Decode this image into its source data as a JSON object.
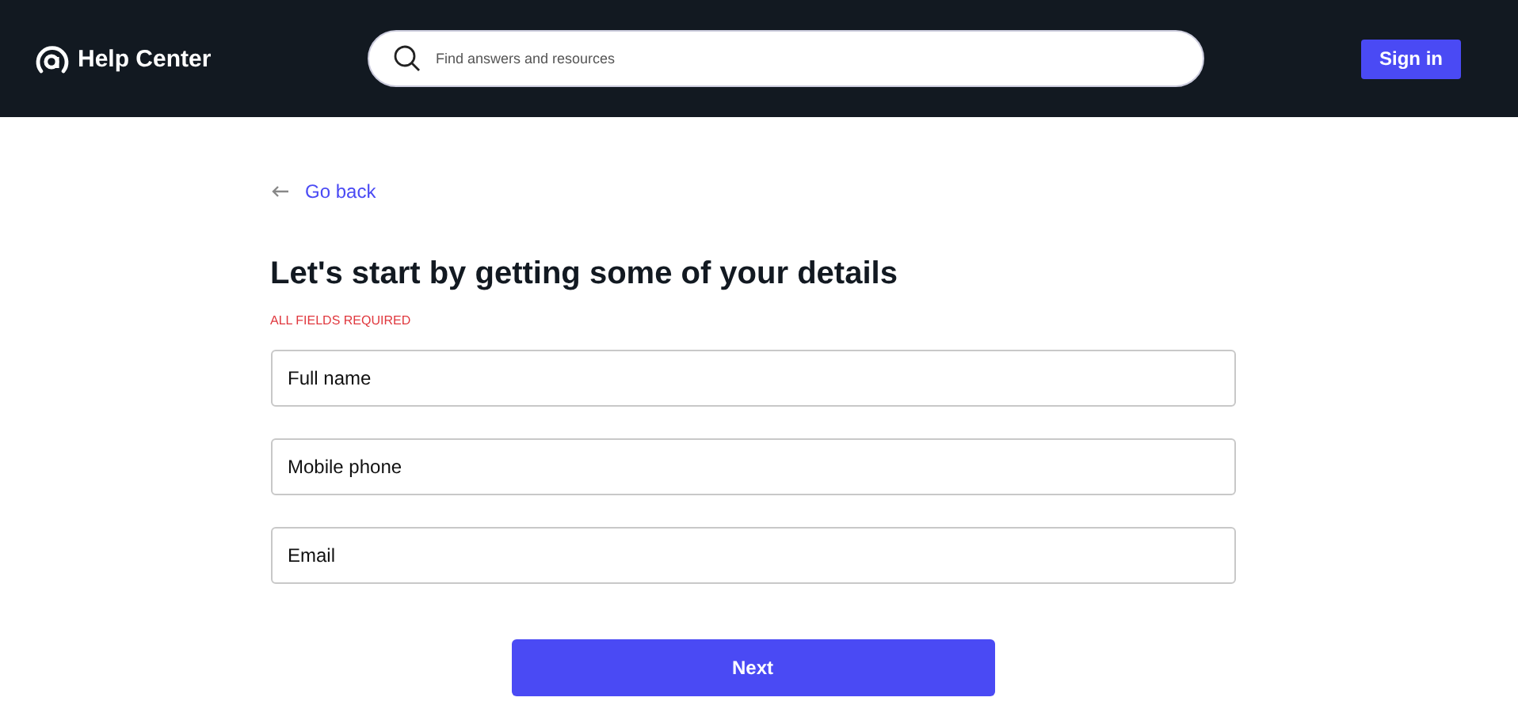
{
  "header": {
    "brand": "Help Center",
    "search": {
      "placeholder": "Find answers and resources"
    },
    "sign_in": "Sign in"
  },
  "back_link": "Go back",
  "title": "Let's start by getting some of your details",
  "required_note": "ALL FIELDS REQUIRED",
  "fields": [
    {
      "placeholder": "Full name"
    },
    {
      "placeholder": "Mobile phone"
    },
    {
      "placeholder": "Email"
    }
  ],
  "submit": "Next"
}
